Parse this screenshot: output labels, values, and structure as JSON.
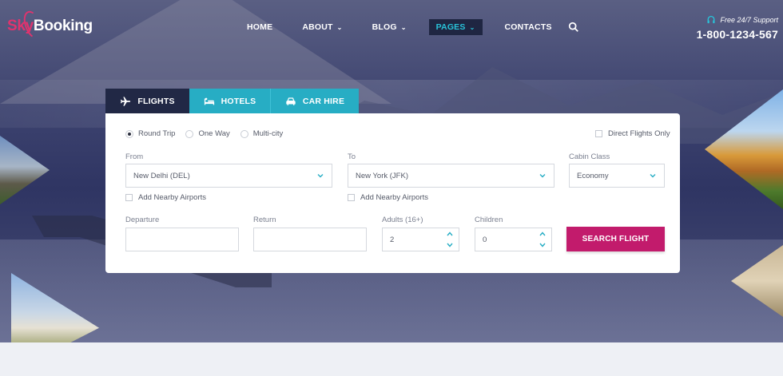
{
  "brand": {
    "part1": "Sky",
    "part2": "Booking"
  },
  "nav": {
    "items": [
      {
        "label": "HOME",
        "caret": ""
      },
      {
        "label": "ABOUT",
        "caret": "⌄"
      },
      {
        "label": "BLOG",
        "caret": "⌄"
      },
      {
        "label": "PAGES",
        "caret": "⌄"
      },
      {
        "label": "CONTACTS",
        "caret": ""
      }
    ],
    "search_icon": "search-icon"
  },
  "support": {
    "label": "Free 24/7 Support",
    "phone": "1-800-1234-567",
    "icon": "headset-icon"
  },
  "tabs": [
    {
      "label": "FLIGHTS",
      "icon": "plane-icon"
    },
    {
      "label": "HOTELS",
      "icon": "bed-icon"
    },
    {
      "label": "CAR HIRE",
      "icon": "car-icon"
    }
  ],
  "trip_types": [
    "Round Trip",
    "One Way",
    "Multi-city"
  ],
  "direct_flights_label": "Direct Flights Only",
  "from": {
    "label": "From",
    "value": "New Delhi (DEL)",
    "nearby": "Add Nearby Airports"
  },
  "to": {
    "label": "To",
    "value": "New York (JFK)",
    "nearby": "Add Nearby Airports"
  },
  "cabin": {
    "label": "Cabin Class",
    "value": "Economy"
  },
  "departure": {
    "label": "Departure",
    "value": ""
  },
  "return": {
    "label": "Return",
    "value": ""
  },
  "adults": {
    "label": "Adults (16+)",
    "value": "2"
  },
  "children": {
    "label": "Children",
    "value": "0"
  },
  "search_button": "SEARCH FLIGHT",
  "colors": {
    "accent_pink": "#e0336e",
    "button": "#c21b6c",
    "teal": "#27adc4",
    "dark_navy": "#212845"
  }
}
